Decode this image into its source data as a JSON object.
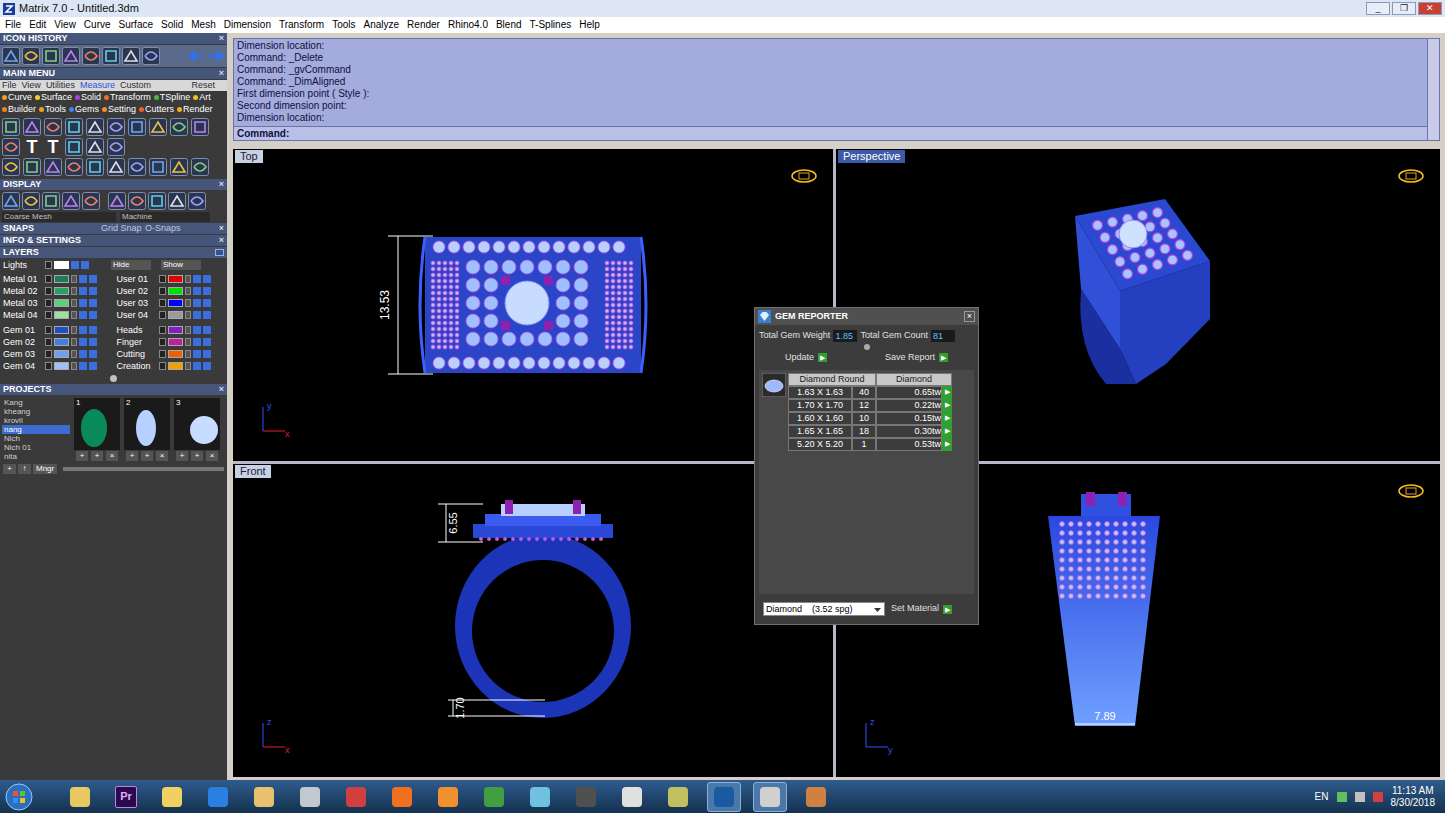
{
  "window": {
    "title": "Matrix 7.0 - Untitled.3dm",
    "controls": [
      "_",
      "❐",
      "✕"
    ]
  },
  "menu": [
    "File",
    "Edit",
    "View",
    "Curve",
    "Surface",
    "Solid",
    "Mesh",
    "Dimension",
    "Transform",
    "Tools",
    "Analyze",
    "Render",
    "Rhino4.0",
    "Blend",
    "T-Splines",
    "Help"
  ],
  "left_panel": {
    "icon_history": {
      "title": "ICON HISTORY",
      "close": "×"
    },
    "main_menu": {
      "title": "MAIN MENU",
      "close": "×",
      "tabs": [
        {
          "label": "File",
          "selected": false
        },
        {
          "label": "View",
          "selected": false
        },
        {
          "label": "Utilities",
          "selected": false
        },
        {
          "label": "Measure",
          "selected": true
        },
        {
          "label": "Custom",
          "selected": false
        }
      ],
      "reset": "Reset",
      "categories": [
        [
          {
            "label": "Curve",
            "color": "#f0a020"
          },
          {
            "label": "Surface",
            "color": "#f0d020"
          },
          {
            "label": "Solid",
            "color": "#b040e0"
          },
          {
            "label": "Transform",
            "color": "#f07020"
          },
          {
            "label": "TSpline",
            "color": "#40c040"
          },
          {
            "label": "Art",
            "color": "#f0c020"
          }
        ],
        [
          {
            "label": "Builder",
            "color": "#f08020"
          },
          {
            "label": "Tools",
            "color": "#f0a020"
          },
          {
            "label": "Gems",
            "color": "#4080f0"
          },
          {
            "label": "Setting",
            "color": "#f09020"
          },
          {
            "label": "Cutters",
            "color": "#f06020"
          },
          {
            "label": "Render",
            "color": "#f0b020"
          }
        ]
      ],
      "tool_glyphs": [
        "T",
        "T"
      ]
    },
    "display": {
      "title": "DISPLAY",
      "close": "×",
      "mode": "Coarse Mesh",
      "material": "Machine"
    },
    "snaps": {
      "title": "SNAPS",
      "close": "×",
      "grid": "Grid Snap",
      "osnaps": "O-Snaps"
    },
    "info": {
      "title": "INFO & SETTINGS",
      "close": "×"
    },
    "layers": {
      "title": "LAYERS",
      "lights": "Lights",
      "hide": "Hide",
      "show": "Show",
      "groups": [
        [
          {
            "name": "Metal 01",
            "color": "#1e7a5c"
          },
          {
            "name": "User 01",
            "color": "#e00000"
          },
          {
            "name": "Metal 02",
            "color": "#2aa060"
          },
          {
            "name": "User 02",
            "color": "#00e000"
          },
          {
            "name": "Metal 03",
            "color": "#5fd07a"
          },
          {
            "name": "User 03",
            "color": "#0000ff"
          },
          {
            "name": "Metal 04",
            "color": "#a0e0a0"
          },
          {
            "name": "User 04",
            "color": "#9a9a9a"
          }
        ],
        [
          {
            "name": "Gem 01",
            "color": "#2050c0"
          },
          {
            "name": "Heads",
            "color": "#8020c0"
          },
          {
            "name": "Gem 02",
            "color": "#3f7fe0"
          },
          {
            "name": "Finger",
            "color": "#c020a0"
          },
          {
            "name": "Gem 03",
            "color": "#6fa0f0"
          },
          {
            "name": "Cutting",
            "color": "#f06000"
          },
          {
            "name": "Gem 04",
            "color": "#a0c0f8"
          },
          {
            "name": "Creation",
            "color": "#f0a000"
          }
        ]
      ]
    },
    "projects": {
      "title": "PROJECTS",
      "close": "×",
      "items": [
        {
          "name": "Kang",
          "selected": false
        },
        {
          "name": "kheang",
          "selected": false
        },
        {
          "name": "krovil",
          "selected": false
        },
        {
          "name": "nang",
          "selected": true
        },
        {
          "name": "Nich",
          "selected": false
        },
        {
          "name": "Nich 01",
          "selected": false
        },
        {
          "name": "nita",
          "selected": false
        }
      ],
      "thumbnails": [
        {
          "number": "1",
          "buttons": [
            "+",
            "+",
            "×"
          ]
        },
        {
          "number": "2",
          "buttons": [
            "+",
            "+",
            "×"
          ]
        },
        {
          "number": "3",
          "buttons": [
            "+",
            "+",
            "×"
          ]
        }
      ],
      "list_buttons": [
        "+",
        "↑"
      ],
      "manager": "Mngr"
    }
  },
  "command": {
    "history": [
      "Dimension location:",
      "Command: _Delete",
      "Command: _gvCommand",
      "Command: _DimAligned",
      "First dimension point ( Style ):",
      "Second dimension point:",
      "Dimension location:"
    ],
    "prompt": "Command:"
  },
  "viewports": [
    {
      "label": "Top",
      "kind": "top",
      "selected": false,
      "dimensions": [
        "13.53"
      ],
      "axes": [
        "y",
        "x"
      ]
    },
    {
      "label": "Perspective",
      "kind": "perspective",
      "selected": true,
      "dimensions": [],
      "axes": []
    },
    {
      "label": "Front",
      "kind": "front",
      "selected": false,
      "dimensions": [
        "6.55",
        "1.70"
      ],
      "axes": [
        "z",
        "x"
      ]
    },
    {
      "label": "",
      "kind": "right",
      "selected": false,
      "dimensions": [
        "7.89"
      ],
      "axes": [
        "z",
        "y"
      ]
    }
  ],
  "gem_reporter": {
    "title": "GEM REPORTER",
    "close": "×",
    "weight_label": "Total Gem Weight",
    "weight": "1.85",
    "count_label": "Total Gem Count",
    "count": "81",
    "update": "Update",
    "save": "Save Report",
    "arrow": "▶",
    "columns": [
      "Diamond Round",
      "Diamond"
    ],
    "rows": [
      {
        "size": "1.63 X 1.63",
        "count": "40",
        "weight": "0.65tw"
      },
      {
        "size": "1.70 X 1.70",
        "count": "12",
        "weight": "0.22tw"
      },
      {
        "size": "1.60 X 1.60",
        "count": "10",
        "weight": "0.15tw"
      },
      {
        "size": "1.65 X 1.65",
        "count": "18",
        "weight": "0.30tw"
      },
      {
        "size": "5.20 X 5.20",
        "count": "1",
        "weight": "0.53tw"
      }
    ],
    "material": "Diamond    (3.52 spg)",
    "set_material": "Set Material"
  },
  "taskbar": {
    "apps": [
      {
        "label": "",
        "color": "#e8c860",
        "selected": false
      },
      {
        "label": "Pr",
        "color": "#2a0a4a",
        "selected": false
      },
      {
        "label": "",
        "color": "#f0d060",
        "selected": false
      },
      {
        "label": "",
        "color": "#2a80e0",
        "selected": false
      },
      {
        "label": "",
        "color": "#e8c070",
        "selected": false
      },
      {
        "label": "",
        "color": "#c0c8d0",
        "selected": false
      },
      {
        "label": "",
        "color": "#d04040",
        "selected": false
      },
      {
        "label": "",
        "color": "#f07020",
        "selected": false
      },
      {
        "label": "",
        "color": "#f09030",
        "selected": false
      },
      {
        "label": "",
        "color": "#40a040",
        "selected": false
      },
      {
        "label": "",
        "color": "#70c0e0",
        "selected": false
      },
      {
        "label": "",
        "color": "#505050",
        "selected": false
      },
      {
        "label": "",
        "color": "#e0e0e0",
        "selected": false
      },
      {
        "label": "",
        "color": "#c0c060",
        "selected": false
      },
      {
        "label": "",
        "color": "#1a5aa0",
        "selected": true
      },
      {
        "label": "",
        "color": "#d0d0d0",
        "selected": true
      },
      {
        "label": "",
        "color": "#d08040",
        "selected": false
      }
    ],
    "language": "EN",
    "time": "11:13 AM",
    "date": "8/30/2018"
  }
}
